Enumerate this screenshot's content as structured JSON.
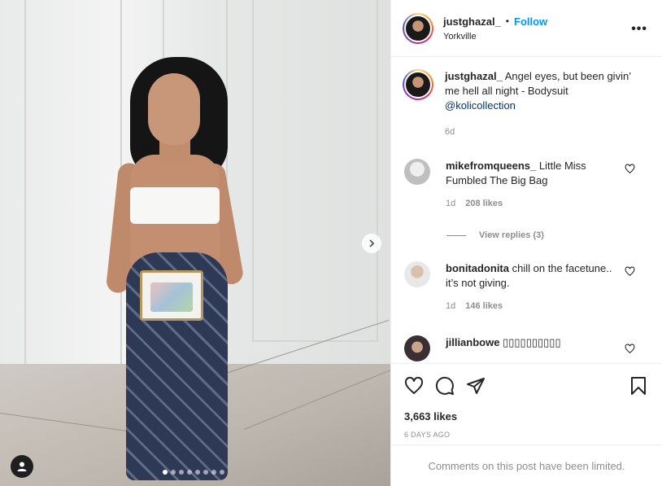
{
  "post": {
    "username": "justghazal_",
    "separator": "•",
    "follow_label": "Follow",
    "location": "Yorkville",
    "more_label": "•••"
  },
  "caption": {
    "username": "justghazal_",
    "text": " Angel eyes, but been givin’ me hell all night - Bodysuit ",
    "mention": "@kolicollection",
    "time": "6d"
  },
  "comments": [
    {
      "username": "mikefromqueens_",
      "text": " Little Miss Fumbled The Big Bag",
      "time": "1d",
      "likes": "208 likes"
    },
    {
      "username": "bonitadonita",
      "text": " chill on the facetune.. it’s not giving.",
      "time": "1d",
      "likes": "146 likes"
    },
    {
      "username": "jillianbowe",
      "text": " ▯▯▯▯▯▯▯▯▯▯"
    }
  ],
  "view_replies": "View replies (3)",
  "likes_count": "3,663 likes",
  "date": "6 DAYS AGO",
  "comments_limited": "Comments on this post have been limited.",
  "carousel": {
    "count": 8,
    "active_index": 0
  },
  "colors": {
    "accent": "#0095f6",
    "muted": "#8e8e8e",
    "text": "#262626"
  }
}
